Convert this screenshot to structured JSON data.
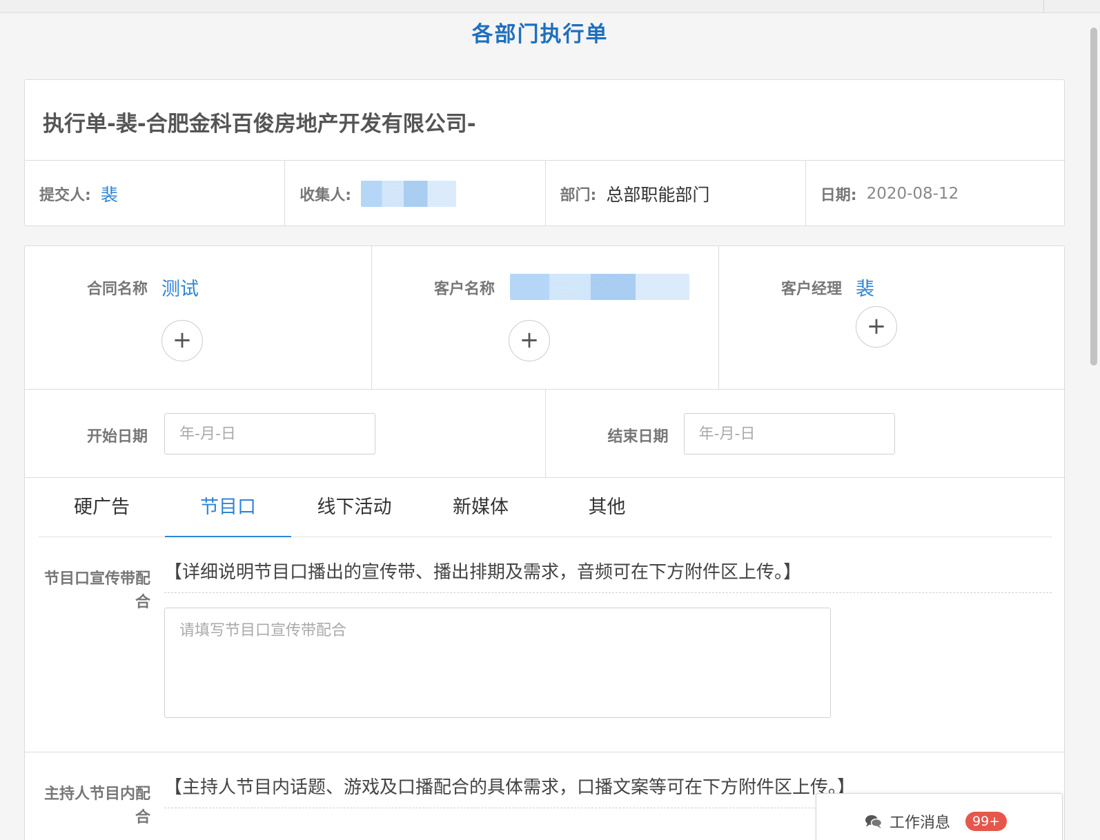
{
  "page": {
    "title": "各部门执行单"
  },
  "header": {
    "order_title": "执行单-裴-合肥金科百俊房地产开发有限公司-",
    "submitter_label": "提交人:",
    "submitter_value": "裴",
    "collector_label": "收集人:",
    "department_label": "部门:",
    "department_value": "总部职能部门",
    "date_label": "日期:",
    "date_value": "2020-08-12"
  },
  "form": {
    "contract_name_label": "合同名称",
    "contract_name_value": "测试",
    "customer_name_label": "客户名称",
    "account_manager_label": "客户经理",
    "account_manager_value": "裴",
    "plus_glyph": "+",
    "start_date_label": "开始日期",
    "start_date_placeholder": "年-月-日",
    "end_date_label": "结束日期",
    "end_date_placeholder": "年-月-日"
  },
  "tabs": [
    {
      "label": "硬广告",
      "active": false
    },
    {
      "label": "节目口",
      "active": true
    },
    {
      "label": "线下活动",
      "active": false
    },
    {
      "label": "新媒体",
      "active": false
    },
    {
      "label": "其他",
      "active": false
    }
  ],
  "sections": {
    "program_promo": {
      "label": "节目口宣传带配合",
      "hint": "【详细说明节目口播出的宣传带、播出排期及需求，音频可在下方附件区上传。】",
      "placeholder": "请填写节目口宣传带配合"
    },
    "host_content": {
      "label": "主持人节目内配合",
      "hint": "【主持人节目内话题、游戏及口播配合的具体需求，口播文案等可在下方附件区上传。】"
    }
  },
  "messages": {
    "label": "工作消息",
    "badge": "99+",
    "icon": "chat-icon"
  },
  "colors": {
    "accent": "#2e84d6",
    "title": "#1e6fbf",
    "badge": "#e5574c"
  }
}
